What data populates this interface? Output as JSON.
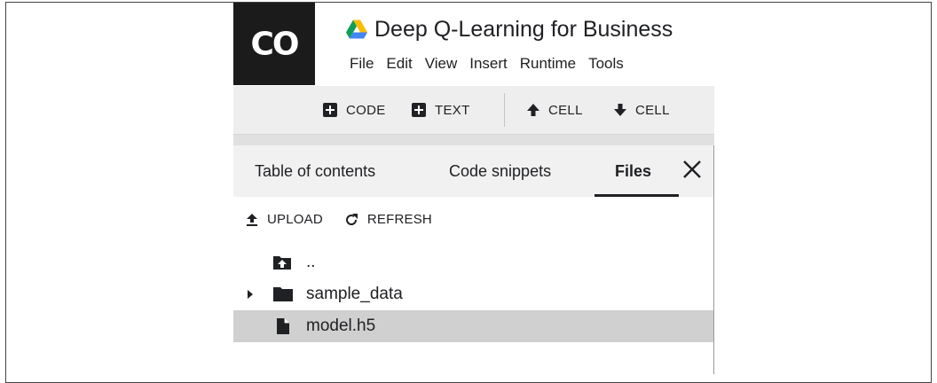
{
  "app": {
    "logo_text": "CO",
    "notebook_title": "Deep Q-Learning for Business",
    "title_icon": "google-drive-icon"
  },
  "menu": [
    "File",
    "Edit",
    "View",
    "Insert",
    "Runtime",
    "Tools"
  ],
  "toolbar": {
    "add_code_label": "CODE",
    "add_text_label": "TEXT",
    "cell_up_label": "CELL",
    "cell_down_label": "CELL",
    "icons": [
      "plus-box-icon",
      "plus-box-icon",
      "arrow-up-icon",
      "arrow-down-icon"
    ]
  },
  "sidebar": {
    "tabs": [
      {
        "label": "Table of contents",
        "active": false
      },
      {
        "label": "Code snippets",
        "active": false
      },
      {
        "label": "Files",
        "active": true
      }
    ],
    "close_icon": "close-icon",
    "actions": {
      "upload_label": "UPLOAD",
      "refresh_label": "REFRESH"
    },
    "files": [
      {
        "name": "..",
        "type": "parent-folder",
        "icon": "folder-up-icon",
        "selected": false,
        "expandable": false
      },
      {
        "name": "sample_data",
        "type": "folder",
        "icon": "folder-icon",
        "selected": false,
        "expandable": true
      },
      {
        "name": "model.h5",
        "type": "file",
        "icon": "file-icon",
        "selected": true,
        "expandable": false
      }
    ]
  },
  "colors": {
    "logo_bg": "#1b1b1b",
    "toolbar_bg": "#eeeeee",
    "tabs_bg": "#f1f1f1",
    "selected_row_bg": "#d0d0d0",
    "text": "#202124"
  }
}
